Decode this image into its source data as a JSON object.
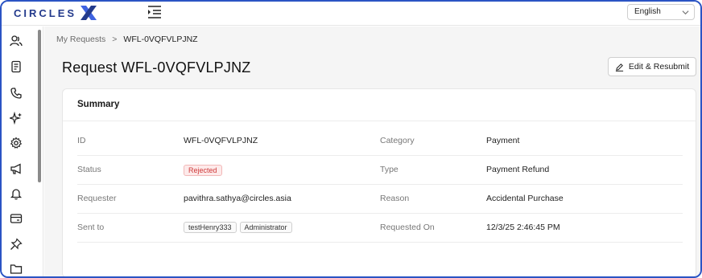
{
  "header": {
    "logo_text": "CIRCLES",
    "logo_icon": "circles-x-logo",
    "menu_icon": "menu-collapse-icon",
    "language": {
      "selected": "English"
    }
  },
  "sidebar": {
    "items": [
      {
        "icon": "users-icon"
      },
      {
        "icon": "document-icon"
      },
      {
        "icon": "phone-icon"
      },
      {
        "icon": "sparkle-icon"
      },
      {
        "icon": "gear-icon"
      },
      {
        "icon": "megaphone-icon"
      },
      {
        "icon": "bell-icon"
      },
      {
        "icon": "card-icon"
      },
      {
        "icon": "pin-icon"
      },
      {
        "icon": "folder-icon"
      }
    ]
  },
  "breadcrumb": {
    "parent": "My Requests",
    "separator": ">",
    "current": "WFL-0VQFVLPJNZ"
  },
  "page": {
    "title": "Request WFL-0VQFVLPJNZ",
    "edit_button": "Edit & Resubmit"
  },
  "summary": {
    "title": "Summary",
    "rows": [
      {
        "left_label": "ID",
        "left_value": "WFL-0VQFVLPJNZ",
        "right_label": "Category",
        "right_value": "Payment"
      },
      {
        "left_label": "Status",
        "left_value": "Rejected",
        "right_label": "Type",
        "right_value": "Payment Refund"
      },
      {
        "left_label": "Requester",
        "left_value": "pavithra.sathya@circles.asia",
        "right_label": "Reason",
        "right_value": "Accidental Purchase"
      },
      {
        "left_label": "Sent to",
        "tags": [
          "testHenry333",
          "Administrator"
        ],
        "right_label": "Requested On",
        "right_value": "12/3/25 2:46:45 PM"
      }
    ]
  },
  "colors": {
    "brand": "#233a8c",
    "frame": "#2b54c4",
    "rejected": "#cf3a3a",
    "background": "#f5f5f5"
  }
}
